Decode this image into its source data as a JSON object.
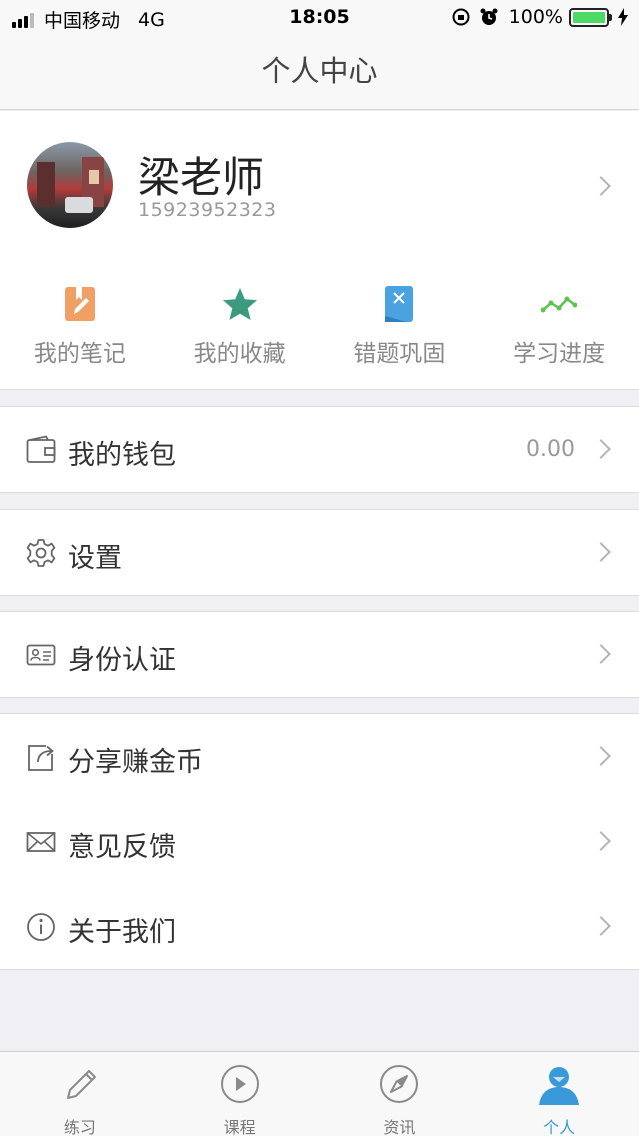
{
  "status_bar": {
    "carrier": "中国移动",
    "network": "4G",
    "time": "18:05",
    "battery": "100%",
    "battery_level": 1.0
  },
  "nav": {
    "title": "个人中心"
  },
  "profile": {
    "name": "梁老师",
    "phone": "15923952323"
  },
  "shortcuts": [
    {
      "label": "我的笔记",
      "icon": "notes-icon",
      "color": "#f0a064"
    },
    {
      "label": "我的收藏",
      "icon": "star-icon",
      "color": "#3b9a80"
    },
    {
      "label": "错题巩固",
      "icon": "wrong-questions-icon",
      "color": "#4aa3e0"
    },
    {
      "label": "学习进度",
      "icon": "progress-icon",
      "color": "#5dc24f"
    }
  ],
  "menu": {
    "wallet": {
      "label": "我的钱包",
      "value": "0.00",
      "icon": "wallet-icon"
    },
    "settings": {
      "label": "设置",
      "icon": "gear-icon"
    },
    "identity": {
      "label": "身份认证",
      "icon": "id-card-icon"
    },
    "share": {
      "label": "分享赚金币",
      "icon": "share-icon"
    },
    "feedback": {
      "label": "意见反馈",
      "icon": "mail-icon"
    },
    "about": {
      "label": "关于我们",
      "icon": "info-icon"
    }
  },
  "tabs": [
    {
      "label": "练习",
      "icon": "pencil-icon",
      "active": false
    },
    {
      "label": "课程",
      "icon": "play-icon",
      "active": false
    },
    {
      "label": "资讯",
      "icon": "compass-icon",
      "active": false
    },
    {
      "label": "个人",
      "icon": "person-icon",
      "active": true
    }
  ],
  "colors": {
    "accent": "#3a9ad9",
    "background": "#efeff4"
  }
}
